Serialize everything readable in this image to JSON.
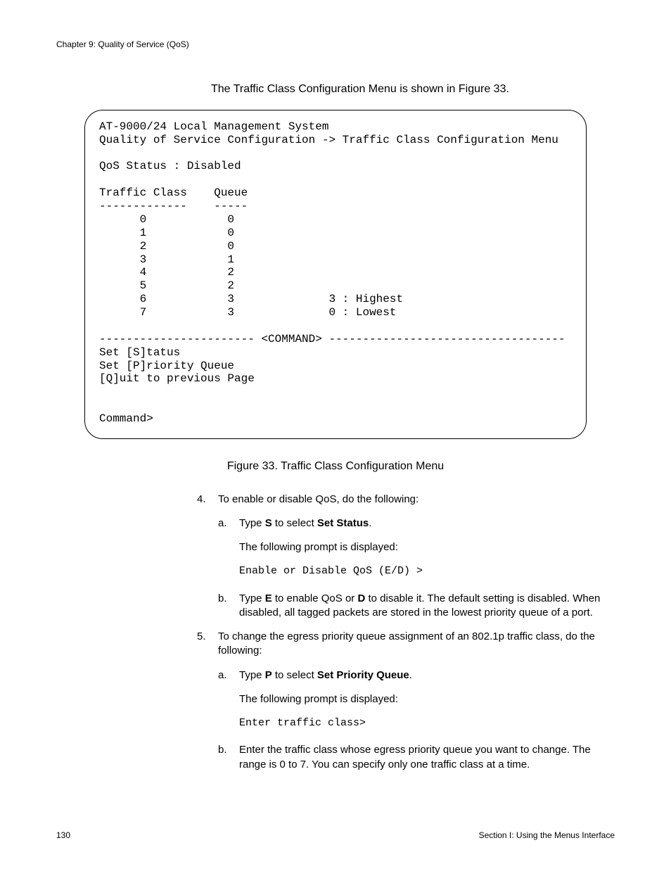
{
  "header": {
    "chapter": "Chapter 9: Quality of Service (QoS)"
  },
  "intro": "The Traffic Class Configuration Menu is shown in Figure 33.",
  "terminal": "AT-9000/24 Local Management System\nQuality of Service Configuration -> Traffic Class Configuration Menu\n\nQoS Status : Disabled\n\nTraffic Class    Queue\n-------------    -----\n      0            0\n      1            0\n      2            0\n      3            1\n      4            2\n      5            2\n      6            3              3 : Highest\n      7            3              0 : Lowest\n\n----------------------- <COMMAND> -----------------------------------\nSet [S]tatus\nSet [P]riority Queue\n[Q]uit to previous Page\n\n\nCommand>",
  "figure_caption": "Figure 33. Traffic Class Configuration Menu",
  "steps": {
    "s4": {
      "num": "4.",
      "text": "To enable or disable QoS, do the following:",
      "a": {
        "letter": "a.",
        "before": "Type ",
        "key": "S",
        "mid": " to select ",
        "bold": "Set Status",
        "after": "."
      },
      "prompt_intro": "The following prompt is displayed:",
      "prompt": "Enable or Disable QoS (E/D) >",
      "b": {
        "letter": "b.",
        "before": "Type ",
        "key1": "E",
        "mid1": " to enable QoS or ",
        "key2": "D",
        "after": " to disable it. The default setting is disabled. When disabled, all tagged packets are stored in the lowest priority queue of a port."
      }
    },
    "s5": {
      "num": "5.",
      "text": "To change the egress priority queue assignment of an 802.1p traffic class, do the following:",
      "a": {
        "letter": "a.",
        "before": "Type ",
        "key": "P",
        "mid": " to select ",
        "bold": "Set Priority Queue",
        "after": "."
      },
      "prompt_intro": "The following prompt is displayed:",
      "prompt": "Enter traffic class>",
      "b": {
        "letter": "b.",
        "text": "Enter the traffic class whose egress priority queue you want to change. The range is 0 to 7. You can specify only one traffic class at a time."
      }
    }
  },
  "footer": {
    "page": "130",
    "section": "Section I: Using the Menus Interface"
  }
}
